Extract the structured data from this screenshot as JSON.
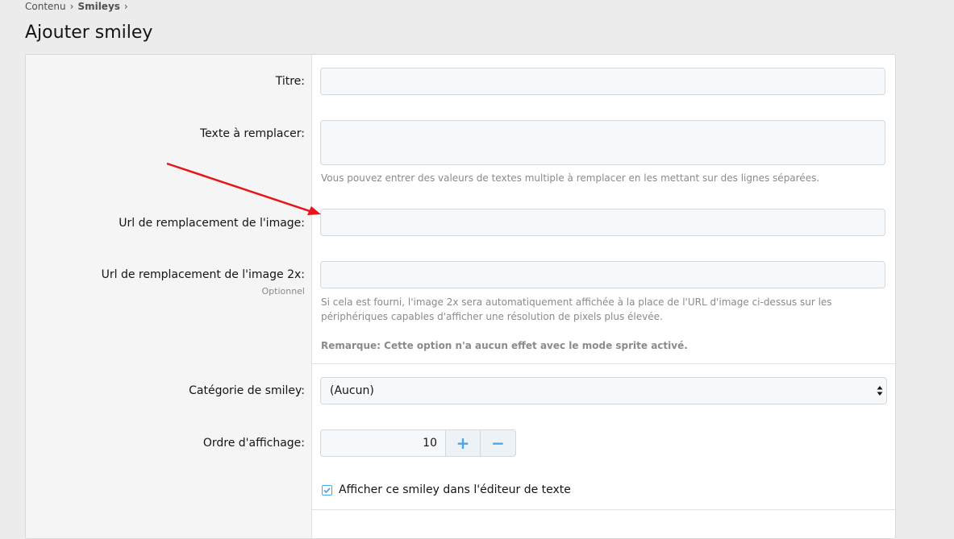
{
  "breadcrumb": {
    "items": [
      "Contenu",
      "Smileys"
    ]
  },
  "page": {
    "title": "Ajouter smiley"
  },
  "form": {
    "title_label": "Titre:",
    "title_value": "",
    "replace_label": "Texte à remplacer:",
    "replace_value": "",
    "replace_hint": "Vous pouvez entrer des valeurs de textes multiple à remplacer en les mettant sur des lignes séparées.",
    "url_label": "Url de remplacement de l'image:",
    "url_value": "",
    "url2x_label": "Url de remplacement de l'image 2x:",
    "url2x_optional": "Optionnel",
    "url2x_value": "",
    "url2x_hint": "Si cela est fourni, l'image 2x sera automatiquement affichée à la place de l'URL d'image ci-dessus sur les périphériques capables d'afficher une résolution de pixels plus élevée.",
    "url2x_note": "Remarque: Cette option n'a aucun effet avec le mode sprite activé.",
    "category_label": "Catégorie de smiley:",
    "category_value": "(Aucun)",
    "order_label": "Ordre d'affichage:",
    "order_value": "10",
    "order_plus": "+",
    "order_minus": "−",
    "show_in_editor_label": "Afficher ce smiley dans l'éditeur de texte",
    "show_in_editor_checked": true
  },
  "colors": {
    "accent": "#47a7eb",
    "annotation_arrow": "#e8141b"
  },
  "icons": {
    "breadcrumb_separator": "chevron-right-icon",
    "select_caret": "sort-caret-icon",
    "checkbox": "check-icon",
    "annotation": "red-arrow-icon"
  }
}
